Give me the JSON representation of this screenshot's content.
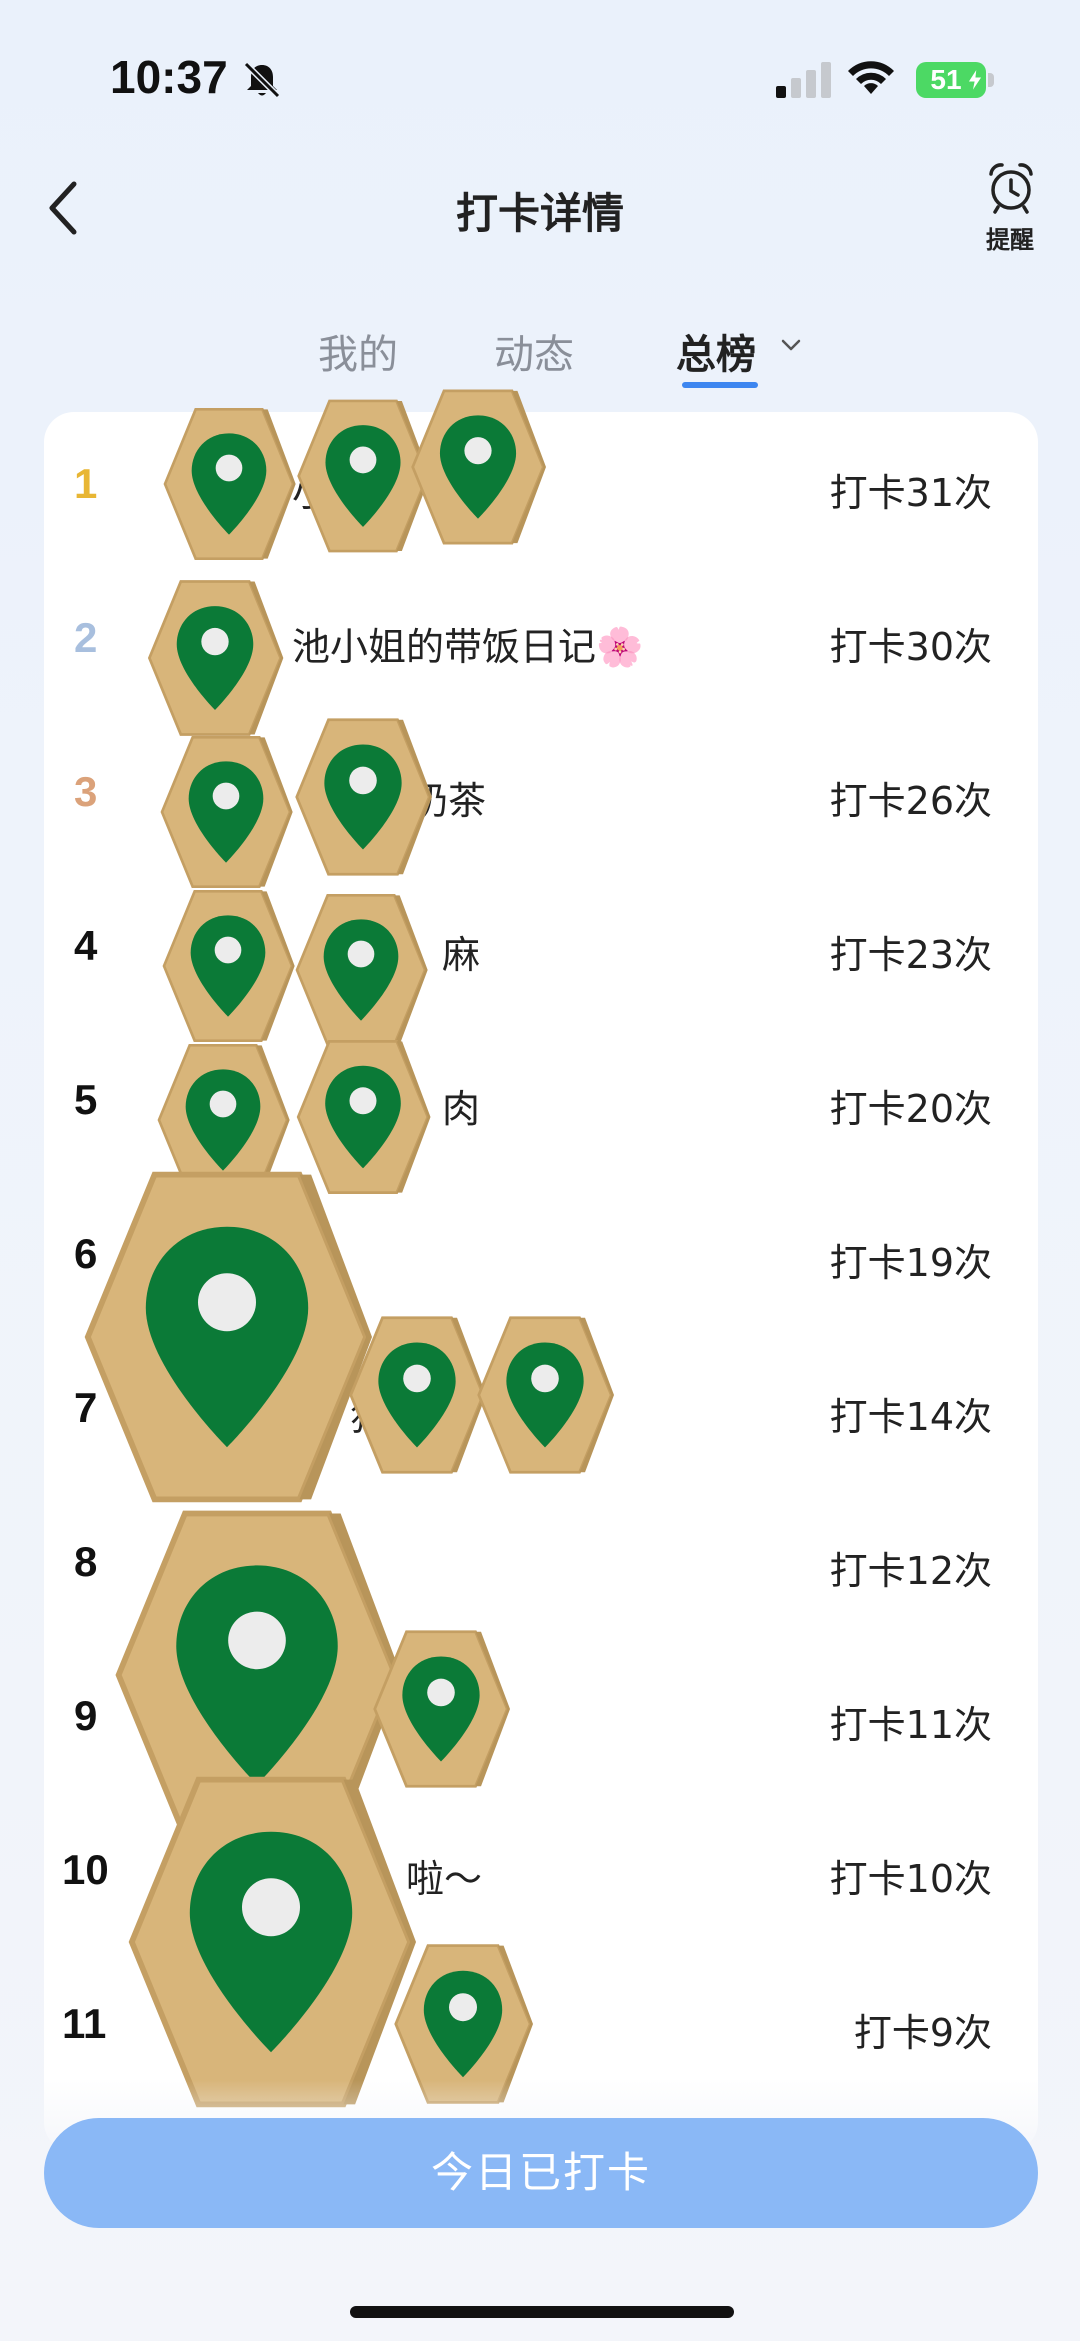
{
  "status_bar": {
    "time": "10:37",
    "battery": "51"
  },
  "nav": {
    "title": "打卡详情",
    "reminder_label": "提醒"
  },
  "tabs": [
    {
      "label": "我的"
    },
    {
      "label": "动态"
    },
    {
      "label": "总榜"
    }
  ],
  "ranking": [
    {
      "rank": "1",
      "name": "小",
      "count": "打卡31次"
    },
    {
      "rank": "2",
      "name": "池小姐的带饭日记🌸",
      "count": "打卡30次"
    },
    {
      "rank": "3",
      "name": "奶茶",
      "count": "打卡26次"
    },
    {
      "rank": "4",
      "name": "麻",
      "count": "打卡23次"
    },
    {
      "rank": "5",
      "name": "肉",
      "count": "打卡20次"
    },
    {
      "rank": "6",
      "name": "",
      "count": "打卡19次"
    },
    {
      "rank": "7",
      "name": "只 猫",
      "count": "打卡14次"
    },
    {
      "rank": "8",
      "name": "",
      "count": "打卡12次"
    },
    {
      "rank": "9",
      "name": "",
      "count": "打卡11次"
    },
    {
      "rank": "10",
      "name": "啦～",
      "count": "打卡10次"
    },
    {
      "rank": "11",
      "name": "( )",
      "count": "打卡9次"
    }
  ],
  "bottom_button": {
    "label": "今日已打卡"
  },
  "colors": {
    "accent": "#3d86f0",
    "button_disabled": "#8ab8f6",
    "rank_gold": "#e8b634",
    "rank_silver": "#a8bfde",
    "rank_bronze": "#dba27a",
    "marker_green": "#0b7a37",
    "marker_tile": "#d8b57a"
  }
}
